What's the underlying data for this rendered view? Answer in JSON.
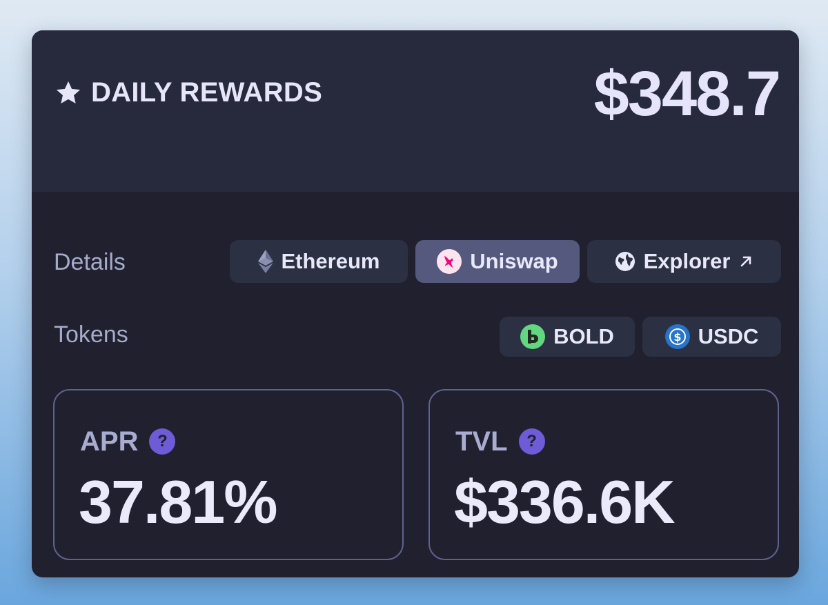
{
  "header": {
    "title": "DAILY REWARDS",
    "amount": "$348.7",
    "icon": "star-icon"
  },
  "details": {
    "label": "Details",
    "links": [
      {
        "label": "Ethereum",
        "icon": "ethereum-icon",
        "active": false
      },
      {
        "label": "Uniswap",
        "icon": "uniswap-icon",
        "active": true
      },
      {
        "label": "Explorer",
        "icon": "globe-icon",
        "trailing_icon": "arrow-up-right-icon",
        "active": false
      }
    ]
  },
  "tokens": {
    "label": "Tokens",
    "items": [
      {
        "label": "BOLD",
        "icon": "bold-token-icon"
      },
      {
        "label": "USDC",
        "icon": "usdc-token-icon"
      }
    ]
  },
  "stats": {
    "apr": {
      "label": "APR",
      "value": "37.81%",
      "help": "?"
    },
    "tvl": {
      "label": "TVL",
      "value": "$336.6K",
      "help": "?"
    }
  },
  "colors": {
    "card_background": "#20202e",
    "header_background": "#262a3c",
    "pill_background": "#2c3043",
    "pill_active_background": "#55597e",
    "accent_purple": "#6d5bd8",
    "stat_border": "#5d6390",
    "bold_green": "#63d77f",
    "usdc_blue": "#2775ca",
    "uniswap_pink": "#ff007a"
  }
}
